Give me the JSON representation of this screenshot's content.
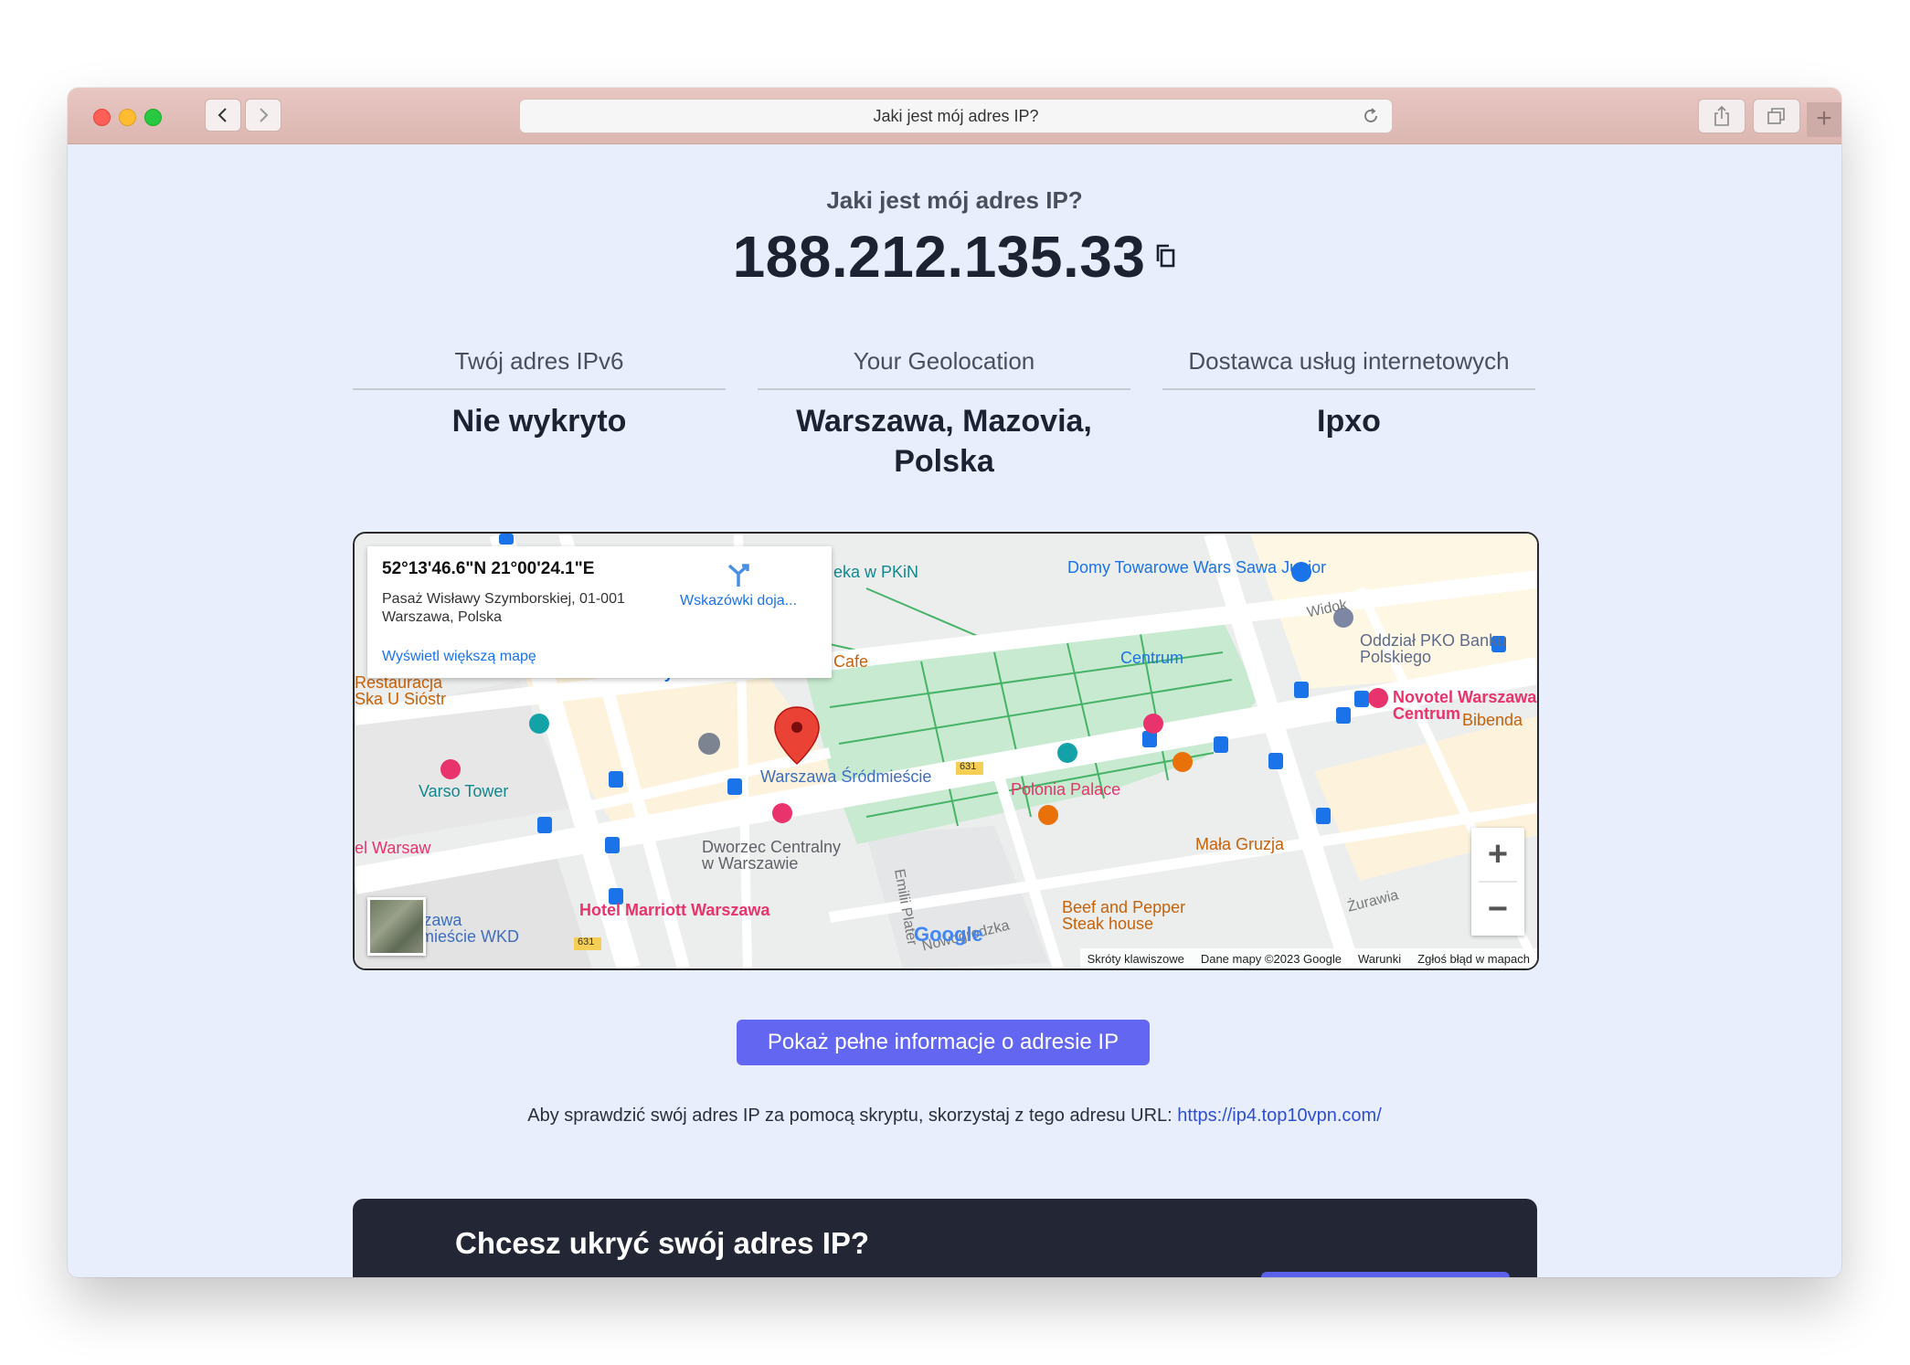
{
  "browser": {
    "url_title": "Jaki jest mój adres IP?"
  },
  "page": {
    "question": "Jaki jest mój adres IP?",
    "ip_address": "188.212.135.33",
    "columns": [
      {
        "label": "Twój adres IPv6",
        "value": "Nie wykryto"
      },
      {
        "label": "Your Geolocation",
        "value": "Warszawa, Mazovia, Polska"
      },
      {
        "label": "Dostawca usług internetowych",
        "value": "Ipxo"
      }
    ],
    "cta_label": "Pokaż pełne informacje o adresie IP",
    "script_text": "Aby sprawdzić swój adres IP za pomocą skryptu, skorzystaj z tego adresu URL:",
    "script_url": "https://ip4.top10vpn.com/",
    "banner_title": "Chcesz ukryć swój adres IP?"
  },
  "map": {
    "coordinates": "52°13'46.6\"N 21°00'24.1\"E",
    "address_line1": "Pasaż Wisławy Szymborskiej, 01-001",
    "address_line2": "Warszawa, Polska",
    "directions_label": "Wskazówki doja...",
    "larger_map_label": "Wyświetl większą mapę",
    "google_logo": "Google",
    "attribution": [
      "Skróty klawiszowe",
      "Dane mapy ©2023 Google",
      "Warunki",
      "Zgłoś błąd w mapach"
    ],
    "places": [
      {
        "name": "Domy Towarowe Wars Sawa Junior",
        "color": "#1a73e8"
      },
      {
        "name": "Oddział PKO Banku Polskiego",
        "color": "#5f6b8a"
      },
      {
        "name": "Novotel Warszawa Centrum",
        "color": "#e8336d"
      },
      {
        "name": "Polonia Palace",
        "color": "#e8336d"
      },
      {
        "name": "Warszawa Śródmieście",
        "color": "#1a73e8"
      },
      {
        "name": "Varso Tower",
        "color": "#12a2a8"
      },
      {
        "name": "Dworzec Centralny w Warszawie",
        "color": "#5f6368"
      },
      {
        "name": "Hotel Marriott Warszawa",
        "color": "#e8336d"
      },
      {
        "name": "Mała Gruzja",
        "color": "#e8710a"
      },
      {
        "name": "Beef and Pepper Steak house",
        "color": "#e8710a"
      },
      {
        "name": "Warszawa Śródmieście WKD",
        "color": "#1a73e8"
      },
      {
        "name": "Restauracja Ska U Sióstr",
        "color": "#e8710a"
      },
      {
        "name": "Bibenda",
        "color": "#e8710a"
      },
      {
        "name": "Centrum",
        "color": "#1a73e8"
      },
      {
        "name": "Złote Tarasy",
        "color": "#1a73e8"
      },
      {
        "name": "Cafe",
        "color": "#e8710a"
      },
      {
        "name": "eka w PKiN",
        "color": "#12a2a8"
      },
      {
        "name": "el Warsaw",
        "color": "#e8336d"
      }
    ],
    "street_labels": [
      "Widok",
      "Żurawia",
      "Emilii Plater",
      "Nowogrodzka",
      "631",
      "631"
    ]
  },
  "colors": {
    "accent": "#6366f1",
    "page_bg": "#e8eefb",
    "banner_bg": "#232735",
    "titlebar": "#e0bdb8"
  }
}
